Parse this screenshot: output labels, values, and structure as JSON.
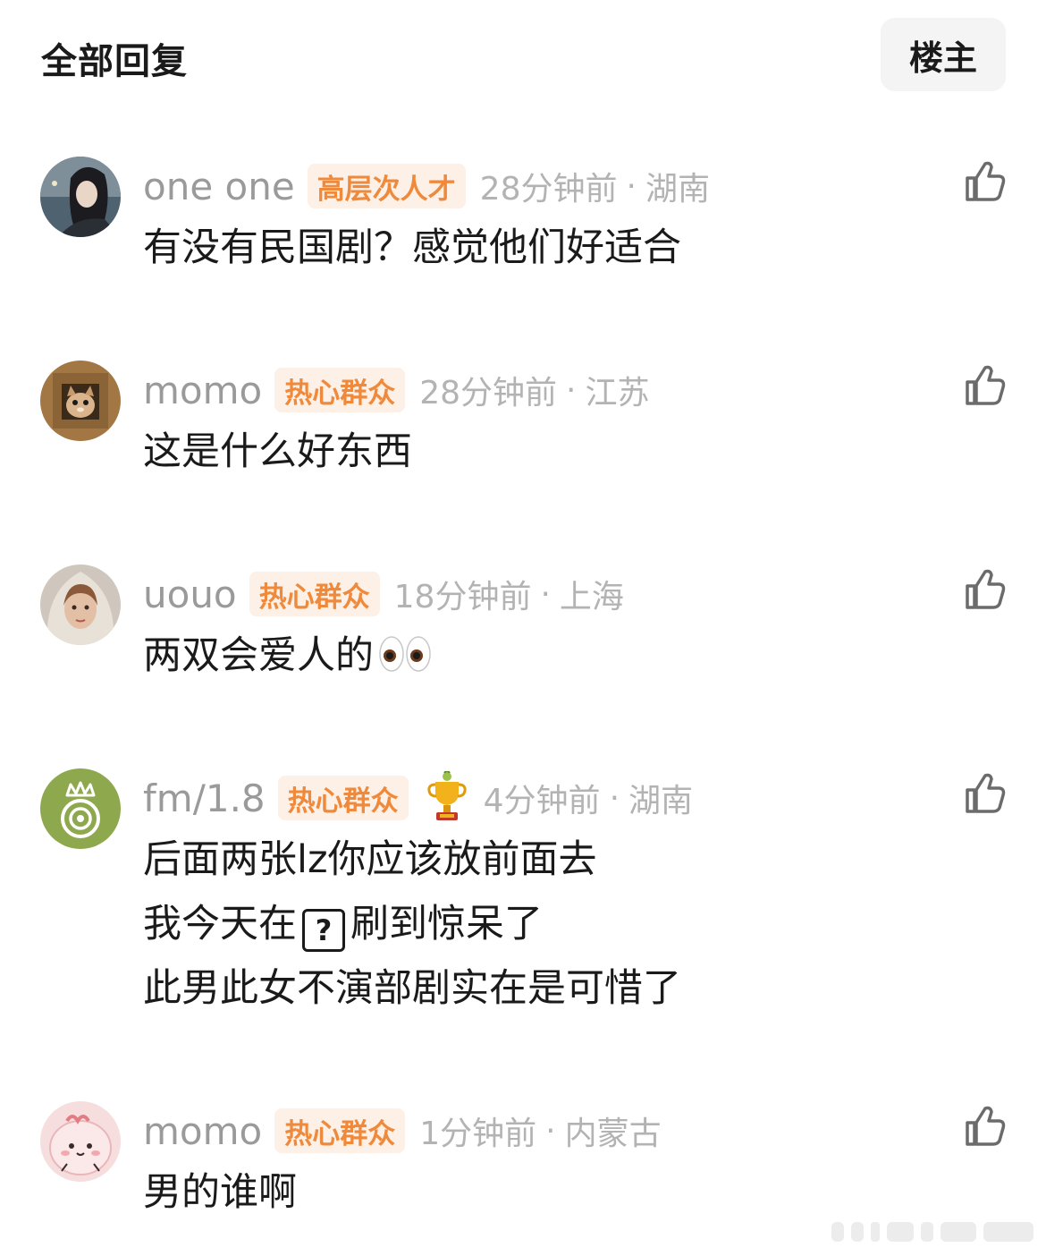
{
  "header": {
    "title": "全部回复",
    "op_button_label": "楼主"
  },
  "comments": [
    {
      "username": "one one",
      "badge": "高层次人才",
      "time": "28分钟前",
      "separator": "·",
      "location": "湖南",
      "text": "有没有民国剧？感觉他们好适合",
      "avatar": "portrait-photo"
    },
    {
      "username": "momo",
      "badge": "热心群众",
      "time": "28分钟前",
      "separator": "·",
      "location": "江苏",
      "text": "这是什么好东西",
      "avatar": "cat-in-box"
    },
    {
      "username": "uouo",
      "badge": "热心群众",
      "time": "18分钟前",
      "separator": "·",
      "location": "上海",
      "text": "两双会爱人的",
      "emoji": "eyes-emoji",
      "avatar": "painted-portrait"
    },
    {
      "username": "fm/1.8",
      "badge": "热心群众",
      "time": "4分钟前",
      "separator": "·",
      "location": "湖南",
      "lines": [
        "后面两张lz你应该放前面去",
        "我今天在",
        "刷到惊呆了",
        "此男此女不演部剧实在是可惜了"
      ],
      "placeholder_glyph": "?",
      "avatar": "green-crown-camera",
      "decoration": "trophy-icon"
    },
    {
      "username": "momo",
      "badge": "热心群众",
      "time": "1分钟前",
      "separator": "·",
      "location": "内蒙古",
      "text": "男的谁啊",
      "avatar": "pink-cartoon-face"
    }
  ],
  "colors": {
    "badge_bg": "#fdf0e6",
    "badge_text": "#ef8a3c",
    "username": "#9a9a9a",
    "meta": "#b3b3b3",
    "text": "#1a1a1a"
  }
}
